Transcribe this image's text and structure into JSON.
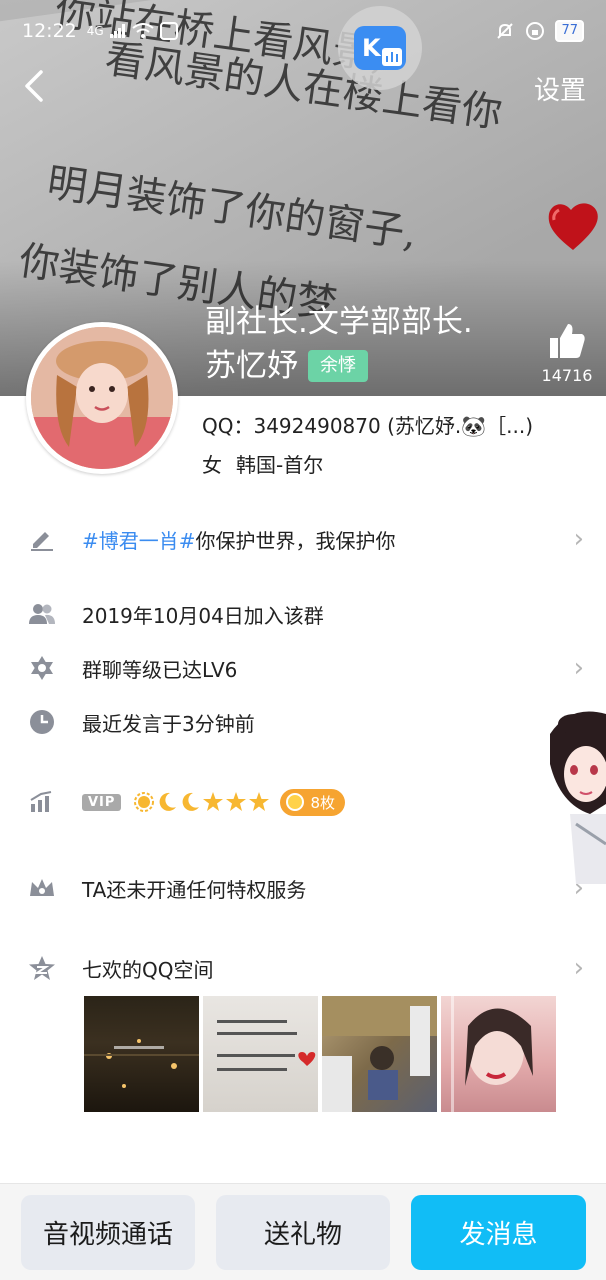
{
  "status_bar": {
    "time": "12:22",
    "network": "4G",
    "battery": "77"
  },
  "header": {
    "back_label": "<",
    "settings_label": "设置",
    "cover_lines": [
      "你站在桥上看风景,",
      "看风景的人在楼上看你",
      "明月装饰了你的窗子,",
      "你装饰了别人的梦"
    ],
    "k_badge": "K"
  },
  "profile": {
    "name_line1": "副社长.文学部部长.",
    "name_line2": "苏忆妤",
    "group_tag": "余悸",
    "likes": "14716",
    "qq_line": "QQ：3492490870 (苏忆妤.🐼［...)",
    "gender": "女",
    "location": "韩国-首尔"
  },
  "rows": {
    "signature_hash": "#博君一肖#",
    "signature_text": "你保护世界，我保护你",
    "join_date": "2019年10月04日加入该群",
    "level": "群聊等级已达LV6",
    "last_speak": "最近发言于3分钟前",
    "vip_label": "VIP",
    "badge_count": "8枚",
    "privilege": "TA还未开通任何特权服务",
    "qzone": "七欢的QQ空间"
  },
  "icons": {
    "edit": "pencil-icon",
    "members": "people-icon",
    "level": "star-of-david-icon",
    "clock": "clock-icon",
    "chart": "bar-chart-icon",
    "crown": "crown-icon",
    "qzone": "qzone-icon",
    "chevron": "chevron-right-icon",
    "like": "thumbs-up-icon"
  },
  "bottom_bar": {
    "video_call": "音视频通话",
    "gift": "送礼物",
    "message": "发消息"
  },
  "colors": {
    "accent": "#11bdf6",
    "hash": "#3b8cf0",
    "tag": "#6cd3a6",
    "badge": "#f6a431"
  }
}
